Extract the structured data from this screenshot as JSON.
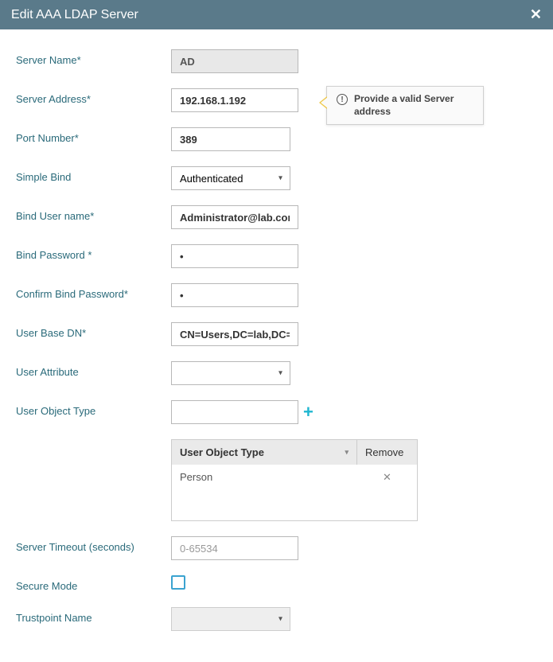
{
  "header": {
    "title": "Edit AAA LDAP Server"
  },
  "tooltip": {
    "text": "Provide a valid Server address"
  },
  "labels": {
    "serverName": "Server Name*",
    "serverAddress": "Server Address*",
    "portNumber": "Port Number*",
    "simpleBind": "Simple Bind",
    "bindUserName": "Bind User name*",
    "bindPassword": "Bind Password *",
    "confirmBindPassword": "Confirm Bind Password*",
    "userBaseDN": "User Base DN*",
    "userAttribute": "User Attribute",
    "userObjectType": "User Object Type",
    "serverTimeout": "Server Timeout (seconds)",
    "secureMode": "Secure Mode",
    "trustpointName": "Trustpoint Name"
  },
  "values": {
    "serverName": "AD",
    "serverAddress": "192.168.1.192",
    "portNumber": "389",
    "simpleBind": "Authenticated",
    "bindUserName": "Administrator@lab.com",
    "bindPassword": "•",
    "confirmBindPassword": "•",
    "userBaseDN": "CN=Users,DC=lab,DC=",
    "userAttribute": "",
    "userObjectType": "",
    "serverTimeoutPlaceholder": "0-65534",
    "trustpointName": ""
  },
  "table": {
    "headers": {
      "col1": "User Object Type",
      "col2": "Remove"
    },
    "rows": [
      {
        "type": "Person"
      }
    ]
  }
}
